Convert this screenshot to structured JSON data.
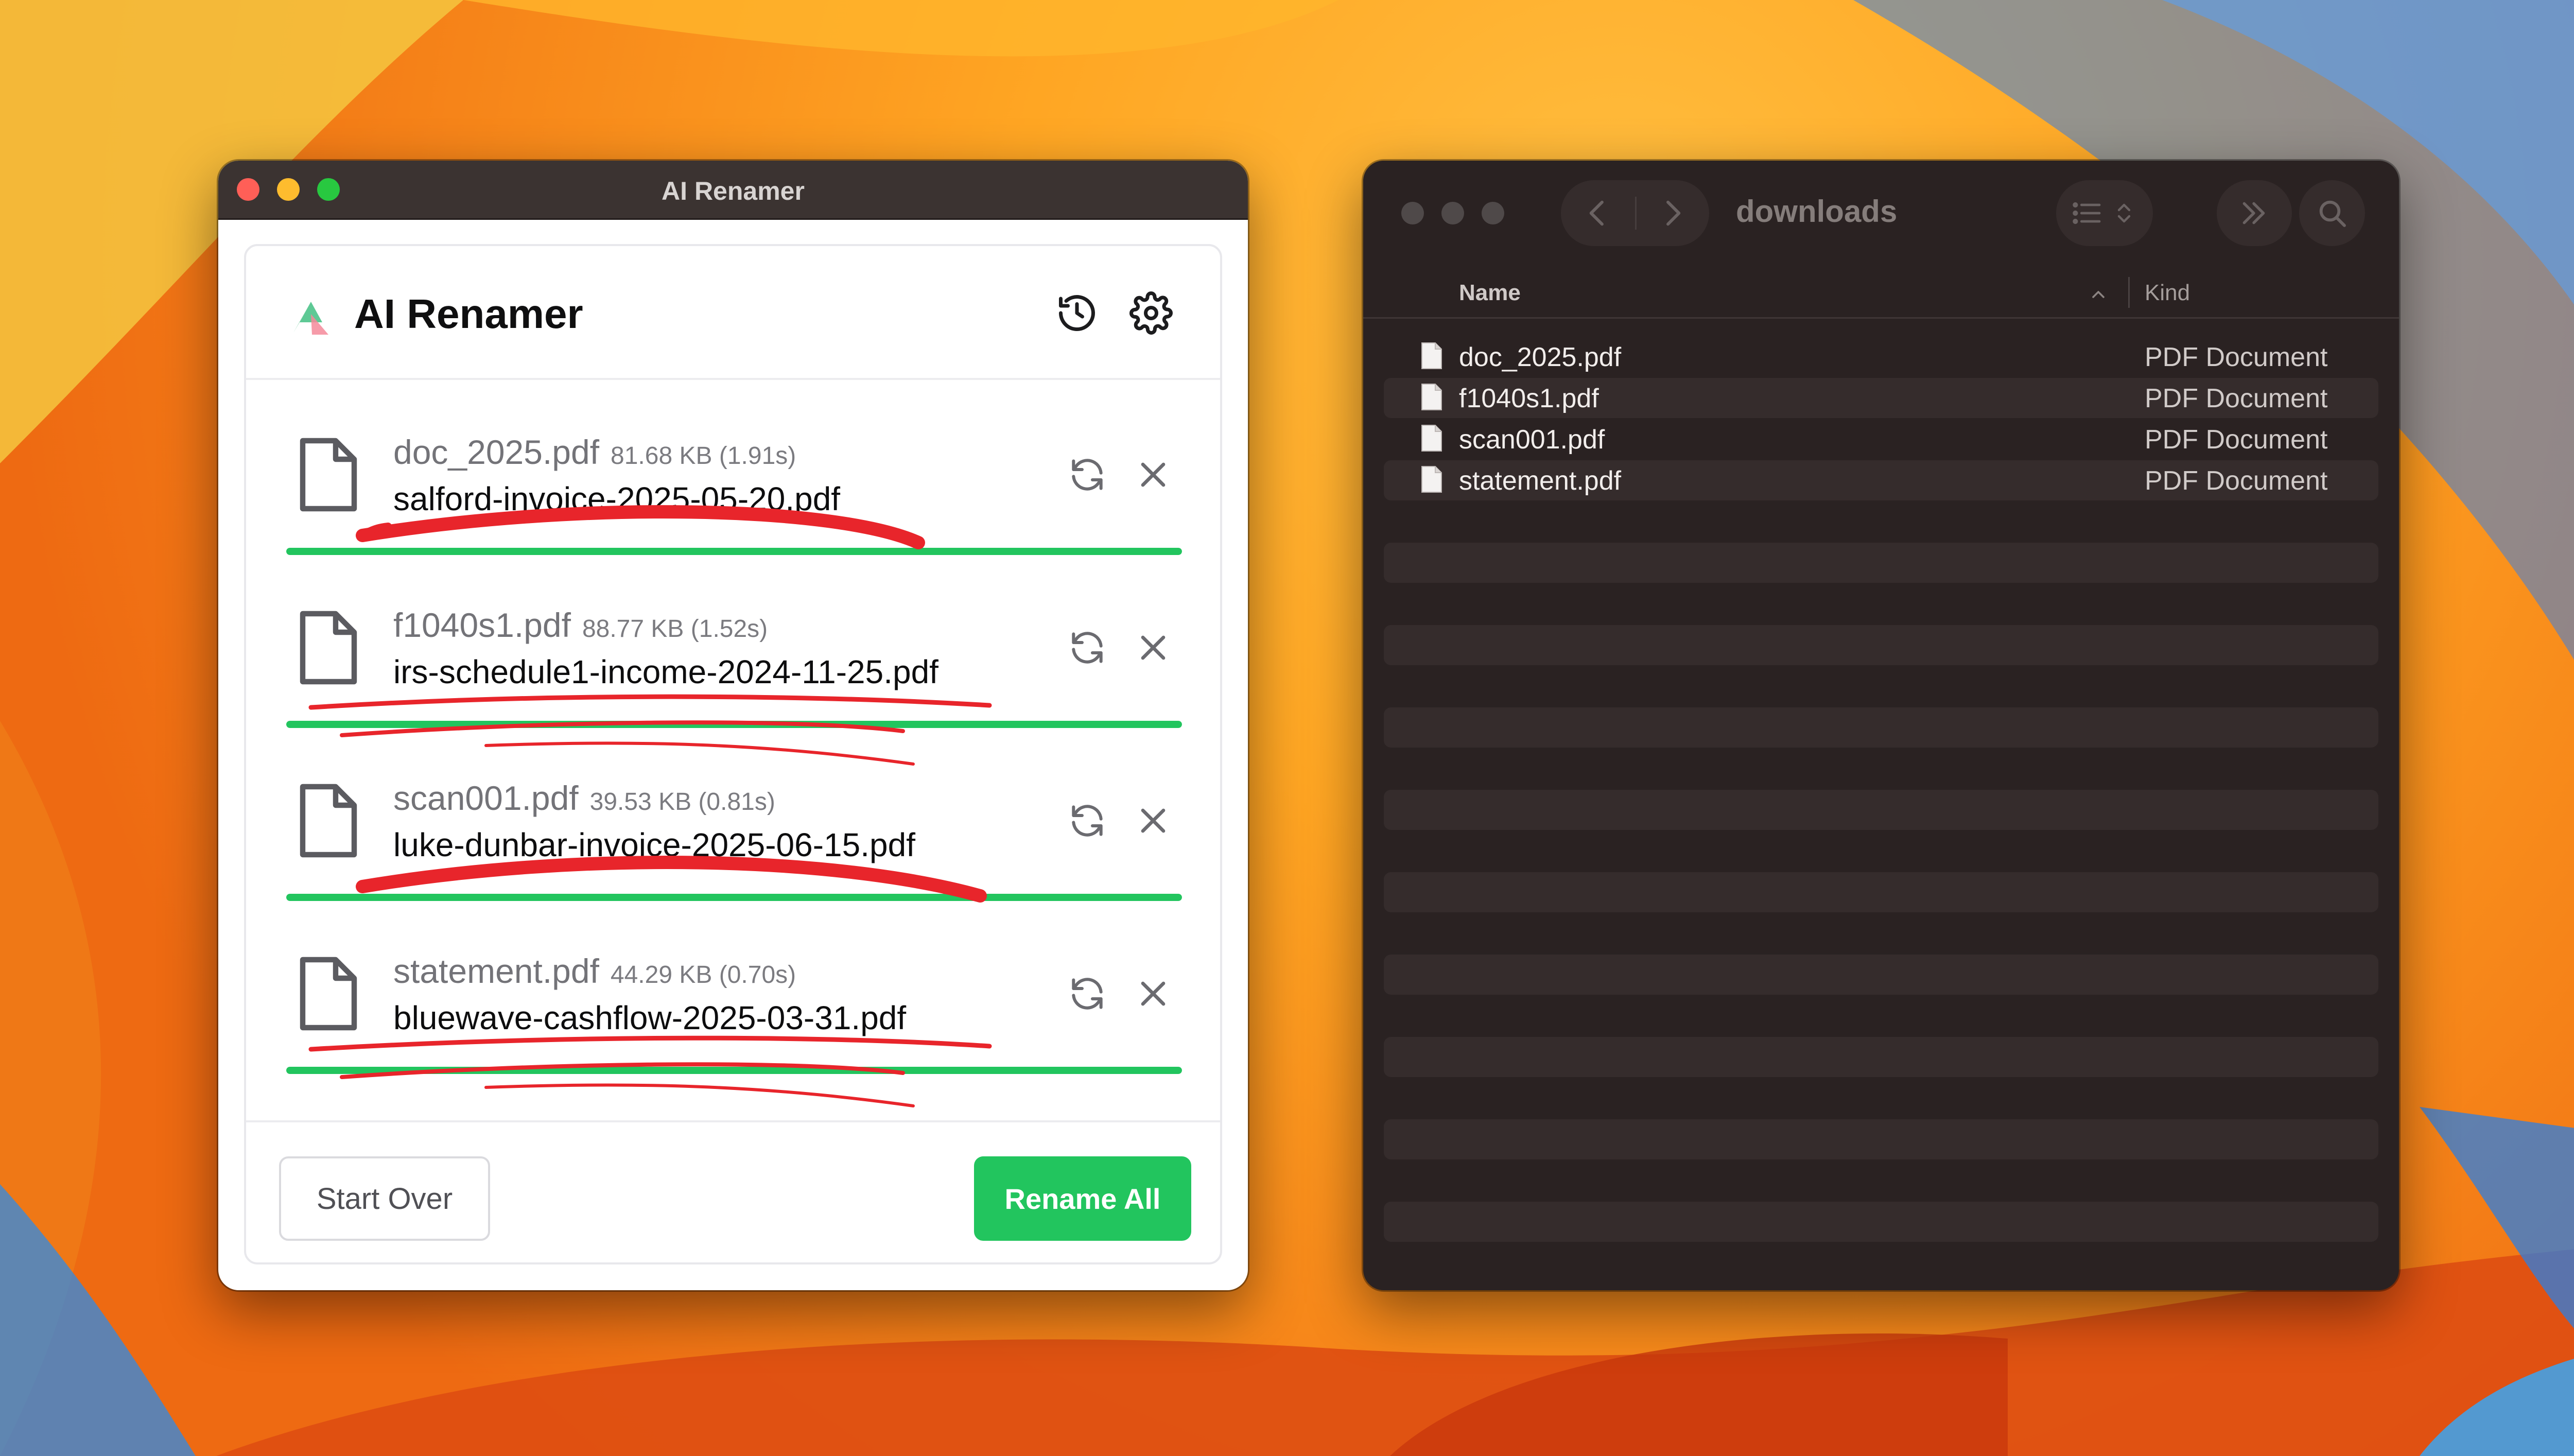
{
  "colors": {
    "accent_green": "#22c55e",
    "annotation_red": "#e8252b",
    "traffic_red": "#ff5f57",
    "traffic_yellow": "#febc2e",
    "traffic_green": "#28c840"
  },
  "renamer_window": {
    "title": "AI Renamer",
    "app_title": "AI Renamer",
    "header_icons": [
      "history-icon",
      "gear-icon"
    ],
    "files": [
      {
        "original": "doc_2025.pdf",
        "meta": "81.68 KB (1.91s)",
        "new_name": "salford-invoice-2025-05-20.pdf",
        "progress": 1.0
      },
      {
        "original": "f1040s1.pdf",
        "meta": "88.77 KB (1.52s)",
        "new_name": "irs-schedule1-income-2024-11-25.pdf",
        "progress": 1.0
      },
      {
        "original": "scan001.pdf",
        "meta": "39.53 KB (0.81s)",
        "new_name": "luke-dunbar-invoice-2025-06-15.pdf",
        "progress": 1.0
      },
      {
        "original": "statement.pdf",
        "meta": "44.29 KB (0.70s)",
        "new_name": "bluewave-cashflow-2025-03-31.pdf",
        "progress": 1.0
      }
    ],
    "row_icons": [
      "file-icon",
      "regenerate-icon",
      "close-icon"
    ],
    "start_over_label": "Start Over",
    "rename_all_label": "Rename All"
  },
  "finder_window": {
    "title": "downloads",
    "columns": {
      "name": "Name",
      "kind": "Kind"
    },
    "files": [
      {
        "name": "doc_2025.pdf",
        "kind": "PDF Document"
      },
      {
        "name": "f1040s1.pdf",
        "kind": "PDF Document"
      },
      {
        "name": "scan001.pdf",
        "kind": "PDF Document"
      },
      {
        "name": "statement.pdf",
        "kind": "PDF Document"
      }
    ]
  }
}
